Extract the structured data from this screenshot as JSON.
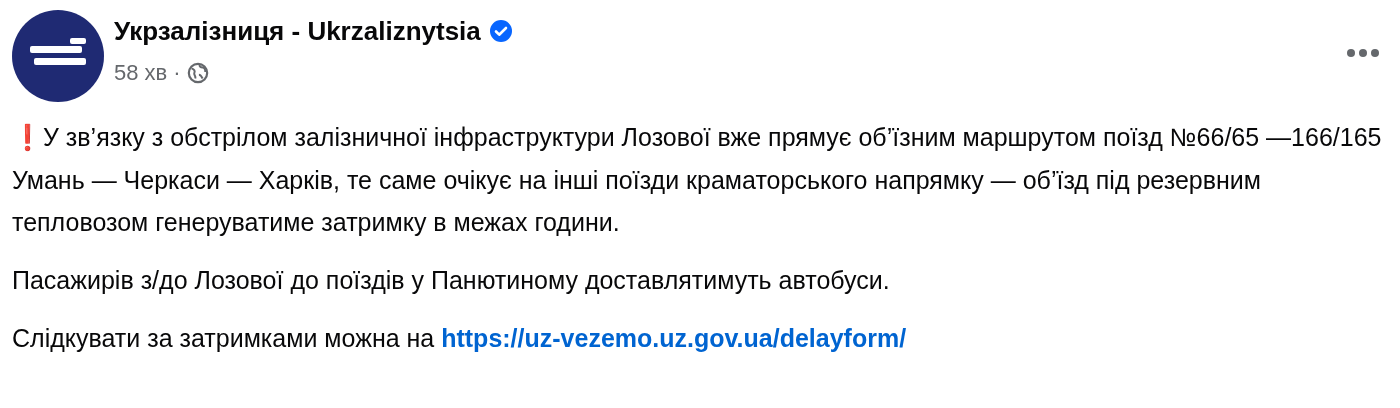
{
  "post": {
    "author": "Укрзалізниця - Ukrzaliznytsia",
    "verified": true,
    "time": "58 хв",
    "separator": "·",
    "paragraphs": [
      {
        "mark": "❗",
        "text": "У зв’язку з обстрілом залізничної інфраструктури Лозової вже прямує об’їзним маршрутом поїзд №66/65 —166/165 Умань — Черкаси — Харків, те саме очікує на інші поїзди краматорського напрямку — об’їзд під резервним тепловозом генеруватиме затримку в межах години."
      },
      {
        "text": "Пасажирів з/до Лозової до поїздів у Панютиному доставлятимуть автобуси."
      },
      {
        "text": "Слідкувати за затримками можна на",
        "link": "https://uz-vezemo.uz.gov.ua/delayform/"
      }
    ]
  }
}
